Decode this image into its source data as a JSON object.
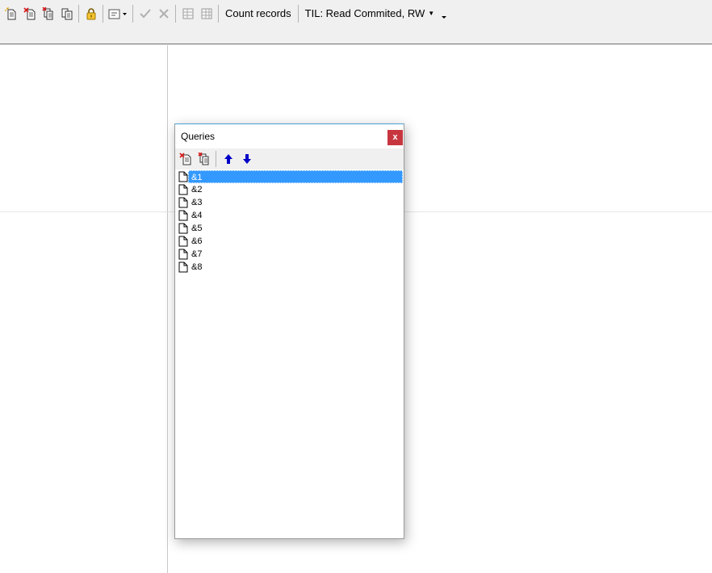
{
  "toolbar": {
    "buttons": [
      {
        "icon": "new-query-icon"
      },
      {
        "icon": "delete-query-icon"
      },
      {
        "icon": "delete-all-queries-icon"
      },
      {
        "icon": "copy-query-icon"
      },
      {
        "icon": "lock-icon"
      },
      {
        "icon": "template-dropdown-icon"
      },
      {
        "icon": "commit-checkmark-icon"
      },
      {
        "icon": "rollback-cross-icon"
      },
      {
        "icon": "grid-icon"
      },
      {
        "icon": "grid-refresh-icon"
      }
    ],
    "count_records_label": "Count records",
    "til_label": "TIL: Read Commited, RW"
  },
  "queries_dialog": {
    "title": "Queries",
    "close_label": "x",
    "items": [
      "&1",
      "&2",
      "&3",
      "&4",
      "&5",
      "&6",
      "&7",
      "&8"
    ],
    "selected_index": 0
  },
  "colors": {
    "selection": "#3399ff",
    "close_button": "#c7363f",
    "arrow_blue": "#0000c8",
    "lock_yellow": "#e8b400",
    "delete_red": "#d81e1e"
  }
}
